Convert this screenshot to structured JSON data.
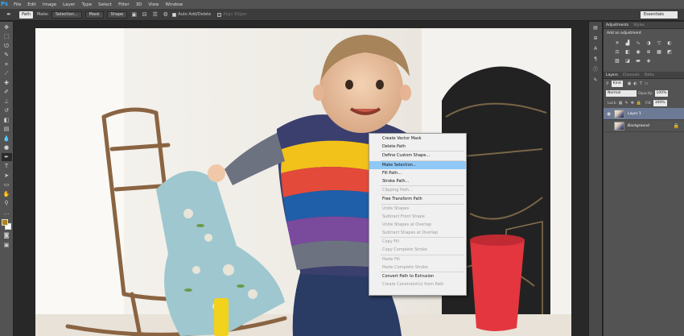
{
  "app": {
    "logo": "Ps",
    "menu": [
      "File",
      "Edit",
      "Image",
      "Layer",
      "Type",
      "Select",
      "Filter",
      "3D",
      "View",
      "Window"
    ]
  },
  "options": {
    "mode_value": "Path",
    "make_label": "Make:",
    "selection_button": "Selection...",
    "mask_button": "Mask",
    "shape_button": "Shape",
    "auto_add_delete": "Auto Add/Delete",
    "align_edges": "Align Edges",
    "workspace_value": "Essentials"
  },
  "adjustments": {
    "tabs": [
      "Adjustments",
      "Styles"
    ],
    "title": "Add an adjustment"
  },
  "layers": {
    "tabs": [
      "Layers",
      "Channels",
      "Paths"
    ],
    "filter_value": "Kind",
    "blend_mode": "Normal",
    "opacity_label": "Opacity:",
    "opacity_value": "100%",
    "lock_label": "Lock:",
    "fill_label": "Fill:",
    "fill_value": "100%",
    "items": [
      {
        "name": "Layer 1",
        "selected": true
      },
      {
        "name": "Background",
        "selected": false
      }
    ]
  },
  "context_menu": [
    {
      "label": "Create Vector Mask",
      "enabled": true
    },
    {
      "label": "Delete Path",
      "enabled": true
    },
    {
      "sep": true
    },
    {
      "label": "Define Custom Shape...",
      "enabled": true
    },
    {
      "sep": true
    },
    {
      "label": "Make Selection...",
      "enabled": true,
      "hover": true
    },
    {
      "label": "Fill Path...",
      "enabled": true
    },
    {
      "label": "Stroke Path...",
      "enabled": true
    },
    {
      "sep": true
    },
    {
      "label": "Clipping Path...",
      "enabled": false
    },
    {
      "sep": true
    },
    {
      "label": "Free Transform Path",
      "enabled": true
    },
    {
      "sep": true
    },
    {
      "label": "Unite Shapes",
      "enabled": false
    },
    {
      "label": "Subtract Front Shape",
      "enabled": false
    },
    {
      "label": "Unite Shapes at Overlap",
      "enabled": false
    },
    {
      "label": "Subtract Shapes at Overlap",
      "enabled": false
    },
    {
      "sep": true
    },
    {
      "label": "Copy Fill",
      "enabled": false
    },
    {
      "label": "Copy Complete Stroke",
      "enabled": false
    },
    {
      "sep": true
    },
    {
      "label": "Paste Fill",
      "enabled": false
    },
    {
      "label": "Paste Complete Stroke",
      "enabled": false
    },
    {
      "sep": true
    },
    {
      "label": "Convert Path to Extrusion",
      "enabled": true
    },
    {
      "label": "Create Constraint(s) from Path",
      "enabled": false
    }
  ],
  "colors": {
    "foreground": "#b38414",
    "background": "#ffffff",
    "menu_hover": "#90c8f6",
    "selected_layer": "#6c7a95"
  }
}
